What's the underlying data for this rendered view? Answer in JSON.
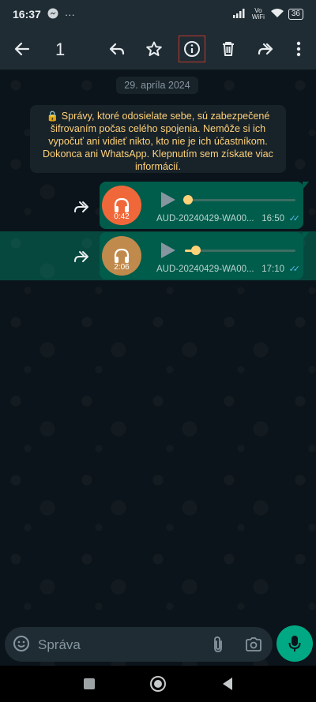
{
  "status_bar": {
    "time": "16:37",
    "messenger_icon": "messenger-icon",
    "more": "···",
    "network_label": "Vo WiFi",
    "battery": "36"
  },
  "toolbar": {
    "selected_count": "1",
    "icons": [
      "back-arrow-icon",
      "reply-icon",
      "star-icon",
      "info-icon",
      "delete-icon",
      "forward-icon",
      "more-vert-icon"
    ]
  },
  "chat": {
    "date_chip": "29. apríla 2024",
    "encryption_notice": "🔒 Správy, ktoré odosielate sebe, sú zabezpečené šifrovaním počas celého spojenia. Nemôže si ich vypočuť ani vidieť nikto, kto nie je ich účastníkom. Dokonca ani WhatsApp. Klepnutím sem získate viac informácií.",
    "messages": [
      {
        "duration": "0:42",
        "filename": "AUD-20240429-WA00...",
        "time": "16:50",
        "ticks": "✓✓",
        "avatar_color": "#f0683a",
        "progress": 0.03,
        "selected": false
      },
      {
        "duration": "2:06",
        "filename": "AUD-20240429-WA00...",
        "time": "17:10",
        "ticks": "✓✓",
        "avatar_color": "#c08a4c",
        "progress": 0.1,
        "selected": true
      }
    ]
  },
  "composer": {
    "placeholder": "Správa"
  },
  "colors": {
    "header": "#1f2c34",
    "bubble": "#005c4b",
    "accent": "#00a884",
    "notice_text": "#ffd279",
    "read_ticks": "#53bdeb"
  }
}
